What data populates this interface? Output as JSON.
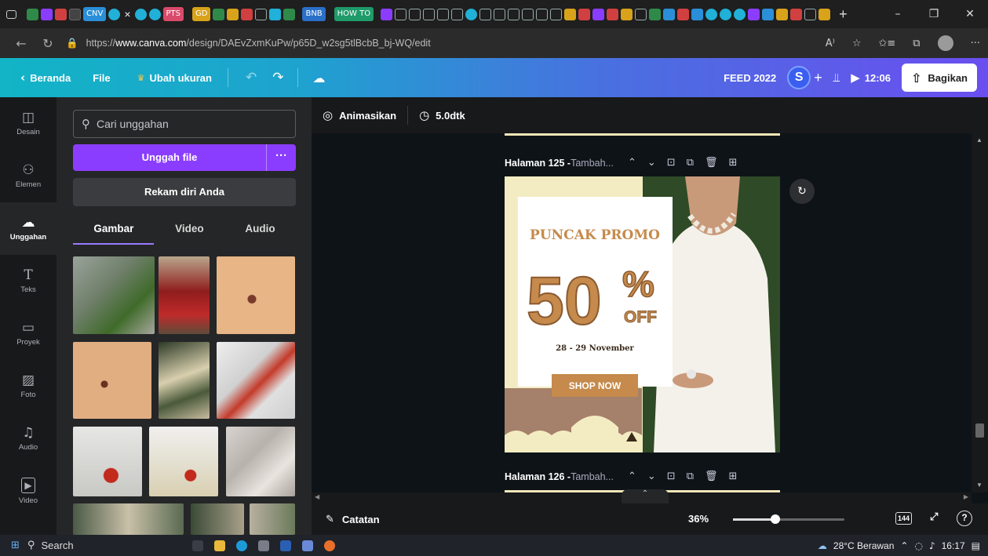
{
  "browser": {
    "tab_chips": [
      {
        "label": "CNV",
        "color": "#2a8fd8"
      },
      {
        "label": "PTS",
        "color": "#d94a6a"
      },
      {
        "label": "GD",
        "color": "#d8a21a"
      },
      {
        "label": "BNB",
        "color": "#2a6fc8"
      },
      {
        "label": "HOW TO",
        "color": "#1f9a6a"
      }
    ],
    "close_tab": "×",
    "new_tab": "+",
    "url_prefix": "https://",
    "url_host": "www.canva.com",
    "url_path": "/design/DAEvZxmKuPw/p65D_w2sg5tlBcbB_bj-WQ/edit",
    "reader_icon": "A⁾",
    "more": "···"
  },
  "topbar": {
    "back_label": "Beranda",
    "file_label": "File",
    "resize_label": "Ubah ukuran",
    "doc_title": "FEED 2022",
    "avatar_letter": "S",
    "timer": "12:06",
    "share_label": "Bagikan"
  },
  "rail": [
    {
      "icon": "◫",
      "label": "Desain"
    },
    {
      "icon": "⚇",
      "label": "Elemen"
    },
    {
      "icon": "☁",
      "label": "Unggahan"
    },
    {
      "icon": "T",
      "label": "Teks"
    },
    {
      "icon": "▭",
      "label": "Proyek"
    },
    {
      "icon": "▨",
      "label": "Foto"
    },
    {
      "icon": "♫",
      "label": "Audio"
    },
    {
      "icon": "▶",
      "label": "Video"
    }
  ],
  "panel": {
    "search_placeholder": "Cari unggahan",
    "upload_label": "Unggah file",
    "upload_more": "···",
    "record_label": "Rekam diri Anda",
    "tabs": [
      "Gambar",
      "Video",
      "Audio"
    ]
  },
  "context_bar": {
    "animate_label": "Animasikan",
    "duration_label": "5.0dtk"
  },
  "pages": [
    {
      "title": "Halaman 125 - ",
      "subtitle": "Tambah..."
    },
    {
      "title": "Halaman 126 - ",
      "subtitle": "Tambah..."
    }
  ],
  "design": {
    "headline": "PUNCAK PROMO",
    "big_number": "50",
    "percent": "%",
    "off": "OFF",
    "dates": "28 - 29 November",
    "cta": "SHOP NOW",
    "colors": {
      "cream": "#f3ecc2",
      "brown": "#c58a4c",
      "taupe": "#a5806a"
    }
  },
  "footer": {
    "notes_label": "Catatan",
    "zoom": "36%",
    "page_count": "144",
    "zoom_fraction": 0.38,
    "help": "?"
  },
  "taskbar": {
    "search_label": "Search",
    "weather": "28°C  Berawan",
    "time": "16:17"
  }
}
